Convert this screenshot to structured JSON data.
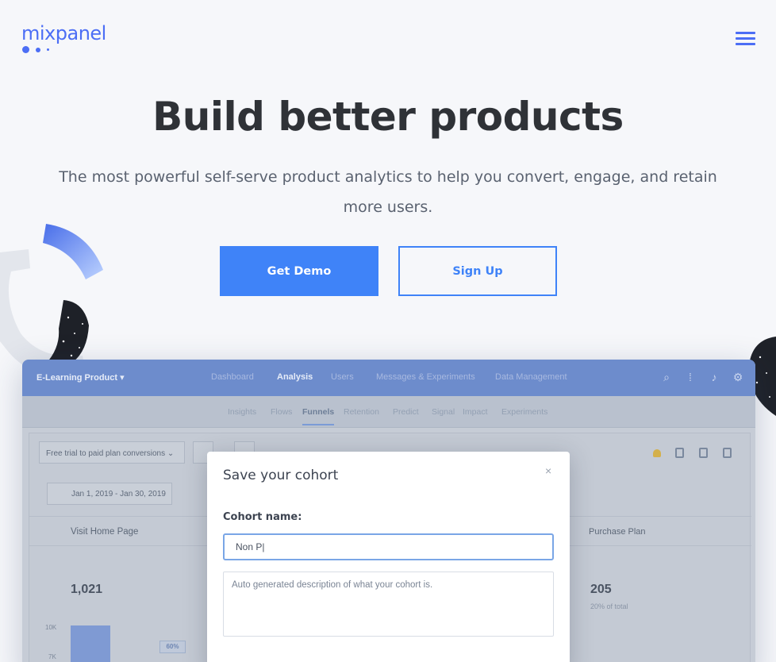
{
  "brand": {
    "logo_text": "mixpanel",
    "accent_color": "#4c6ef5"
  },
  "nav": {
    "menu_icon": "hamburger-menu-icon"
  },
  "hero": {
    "title": "Build better products",
    "subtitle": "The most powerful self-serve product analytics to help you convert, engage, and retain more users.",
    "primary_button": "Get Demo",
    "secondary_button": "Sign Up",
    "button_color": "#3f83f8"
  },
  "app": {
    "project_name": "E-Learning Product",
    "top_nav": [
      "Dashboard",
      "Analysis",
      "Users",
      "Messages & Experiments",
      "Data Management"
    ],
    "top_nav_active": "Analysis",
    "top_icons": [
      "search-icon",
      "apps-grid-icon",
      "bell-icon",
      "settings-icon"
    ],
    "sub_nav": [
      "Insights",
      "Flows",
      "Funnels",
      "Retention",
      "Predict",
      "Signal",
      "Impact",
      "Experiments"
    ],
    "sub_nav_active": "Funnels",
    "report_select": "Free trial to paid plan conversions",
    "date_range": "Jan 1, 2019 - Jan 30, 2019",
    "step_first": "Visit Home Page",
    "step_last": "Purchase Plan",
    "first_value": "1,021",
    "last_value": "205",
    "last_percent": "20% of total",
    "y_axis": [
      "10K",
      "7K"
    ],
    "conversion_badge": "60%"
  },
  "modal": {
    "title": "Save your cohort",
    "close_label": "×",
    "name_label": "Cohort name:",
    "name_value": "Non P|",
    "description_placeholder": "Auto generated description of what your cohort is."
  }
}
